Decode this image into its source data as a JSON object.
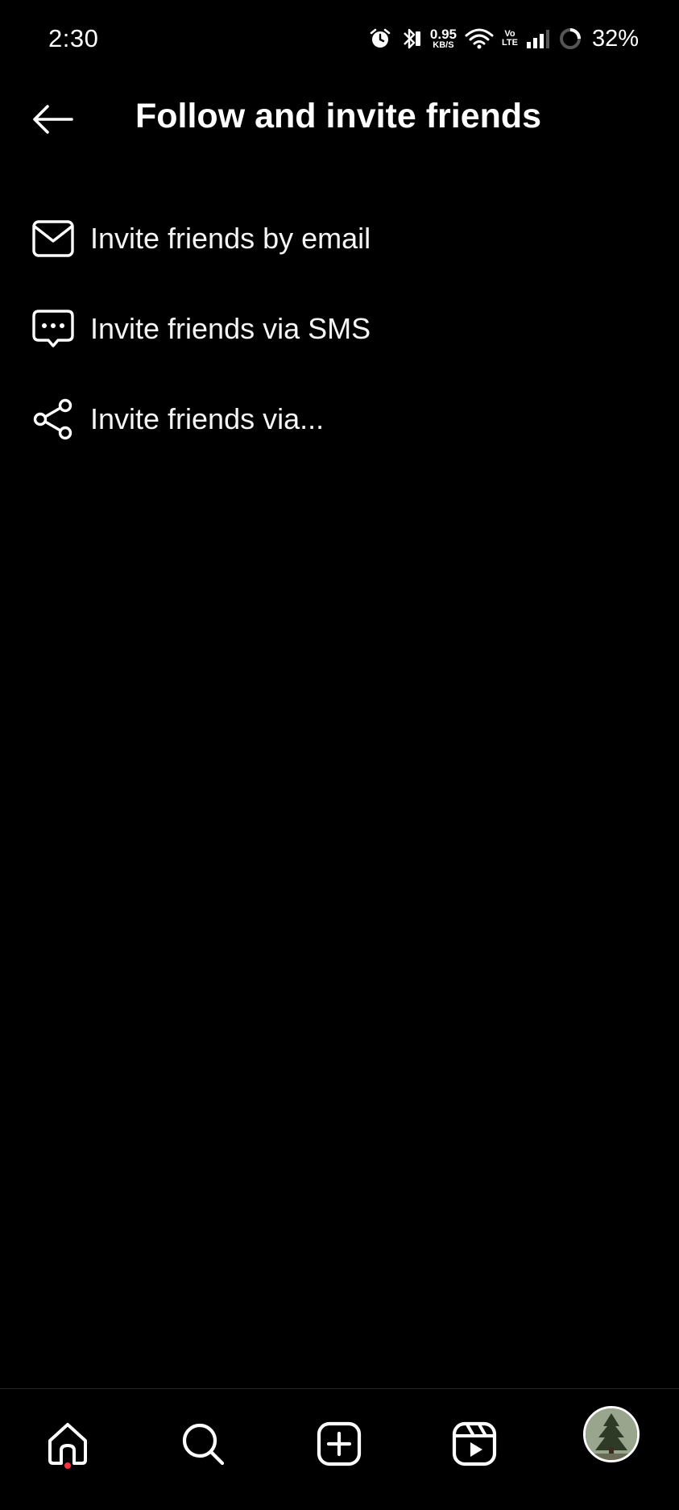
{
  "status_bar": {
    "time": "2:30",
    "net_speed_value": "0.95",
    "net_speed_unit": "KB/S",
    "volte_top": "Vo",
    "volte_bottom": "LTE",
    "battery": "32%",
    "icons": [
      "alarm-icon",
      "bluetooth-icon",
      "wifi-icon",
      "signal-icon",
      "battery-ring-icon"
    ]
  },
  "header": {
    "title": "Follow and invite friends",
    "back_icon": "back-arrow-icon"
  },
  "menu": {
    "items": [
      {
        "label": "Invite friends by email",
        "icon": "mail-icon"
      },
      {
        "label": "Invite friends via SMS",
        "icon": "chat-bubble-icon"
      },
      {
        "label": "Invite friends via...",
        "icon": "share-icon"
      }
    ]
  },
  "bottom_nav": {
    "items": [
      "home-icon",
      "search-icon",
      "create-icon",
      "reels-icon",
      "profile-avatar"
    ],
    "active_dot_color": "#ff3040"
  }
}
